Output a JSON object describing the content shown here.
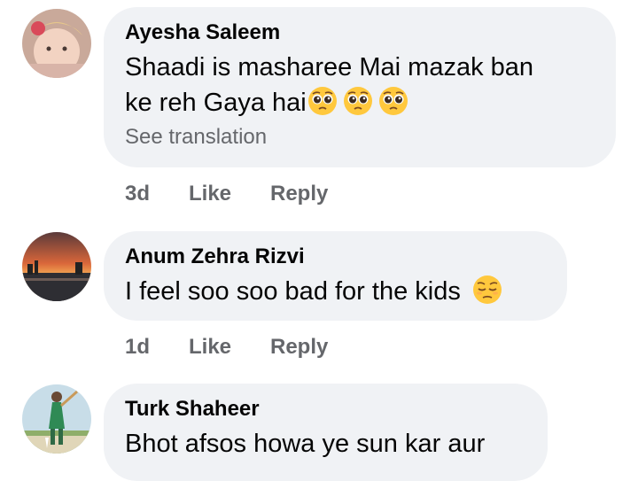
{
  "comments": [
    {
      "author": "Ayesha Saleem",
      "text_line1": "Shaadi is masharee Mai mazak ban",
      "text_line2": "ke reh Gaya hai",
      "see_translation": "See translation",
      "age": "3d",
      "like_label": "Like",
      "reply_label": "Reply",
      "emoji": "pleading-face-icon x3"
    },
    {
      "author": "Anum Zehra Rizvi",
      "text": "I feel soo soo bad for the kids ",
      "age": "1d",
      "like_label": "Like",
      "reply_label": "Reply",
      "emoji": "pensive-face-icon"
    },
    {
      "author": "Turk Shaheer",
      "text": "Bhot afsos howa ye sun kar aur"
    }
  ],
  "colors": {
    "bubble_bg": "#f0f2f5",
    "text": "#050505",
    "secondary_text": "#65676b",
    "emoji_yellow": "#ffc83d"
  }
}
